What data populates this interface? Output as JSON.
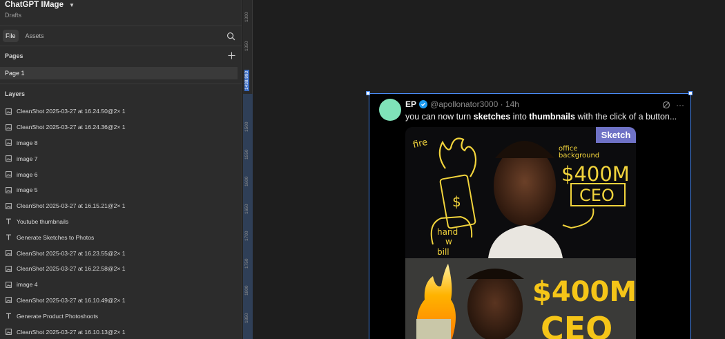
{
  "file": {
    "title": "ChatGPT IMage",
    "subtitle": "Drafts"
  },
  "tabs": [
    {
      "label": "File",
      "active": true
    },
    {
      "label": "Assets",
      "active": false
    }
  ],
  "pages": {
    "label": "Pages",
    "items": [
      {
        "label": "Page 1",
        "selected": true
      }
    ]
  },
  "layers": {
    "label": "Layers",
    "items": [
      {
        "label": "CleanShot 2025-03-27 at 16.24.50@2× 1",
        "icon": "image-icon"
      },
      {
        "label": "CleanShot 2025-03-27 at 16.24.36@2× 1",
        "icon": "image-icon"
      },
      {
        "label": "image 8",
        "icon": "image-icon"
      },
      {
        "label": "image 7",
        "icon": "image-icon"
      },
      {
        "label": "image 6",
        "icon": "image-icon"
      },
      {
        "label": "image 5",
        "icon": "image-icon"
      },
      {
        "label": "CleanShot 2025-03-27 at 16.15.21@2× 1",
        "icon": "image-icon"
      },
      {
        "label": "Youtube thumbnails",
        "icon": "text-icon"
      },
      {
        "label": "Generate Sketches to Photos",
        "icon": "text-icon"
      },
      {
        "label": "CleanShot 2025-03-27 at 16.23.55@2× 1",
        "icon": "image-icon"
      },
      {
        "label": "CleanShot 2025-03-27 at 16.22.58@2× 1",
        "icon": "image-icon"
      },
      {
        "label": "image 4",
        "icon": "image-icon"
      },
      {
        "label": "CleanShot 2025-03-27 at 16.10.49@2× 1",
        "icon": "image-icon"
      },
      {
        "label": "Generate Product Photoshoots",
        "icon": "text-icon"
      },
      {
        "label": "CleanShot 2025-03-27 at 16.10.13@2× 1",
        "icon": "image-icon"
      }
    ]
  },
  "ruler": {
    "ticks": [
      "1300",
      "1350",
      "1438.993",
      "1500",
      "1550",
      "1600",
      "1650",
      "1700",
      "1750",
      "1800",
      "1850"
    ],
    "highlight": "1438.993"
  },
  "tweet": {
    "name": "EP",
    "handle": "@apollonator3000 · 14h",
    "text_before": "you can now turn ",
    "bold1": "sketches",
    "text_mid": " into ",
    "bold2": "thumbnails",
    "text_after": " with the click of a button...",
    "more": "···",
    "badge": "Sketch",
    "sketch_words": [
      "fire",
      "office",
      "background",
      "$",
      "hand",
      "w",
      "bill",
      "$400M",
      "CEO"
    ],
    "photo_words": [
      "$400M",
      "CEO"
    ]
  },
  "colors": {
    "accent": "#4a8cf7",
    "panel": "#2c2c2c",
    "canvas": "#1e1e1e",
    "sketch_yellow": "#f2d43c",
    "photo_gold": "#f5c518",
    "avatar": "#7fe2b9"
  }
}
